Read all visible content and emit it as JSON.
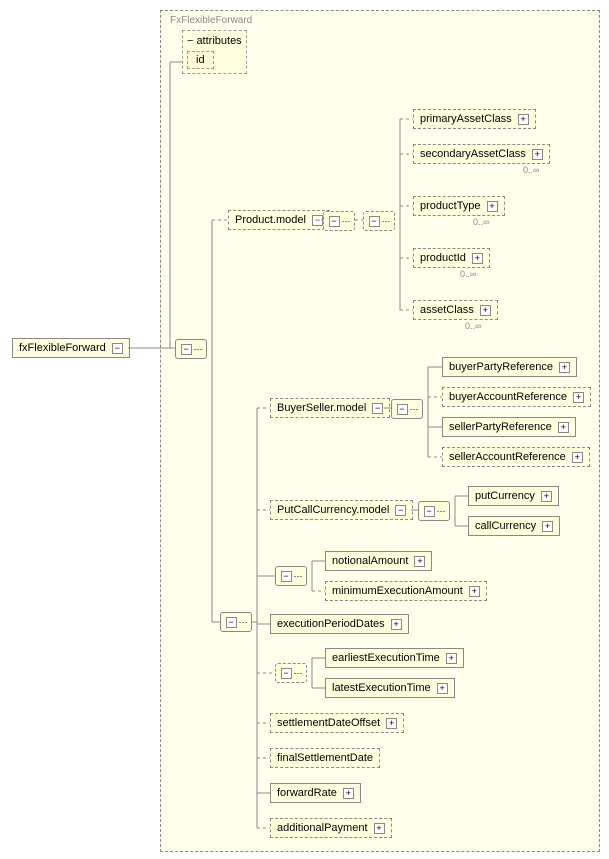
{
  "group": {
    "title": "FxFlexibleForward"
  },
  "root": {
    "label": "fxFlexibleForward"
  },
  "attributes": {
    "header": "attributes",
    "id": "id"
  },
  "productModel": {
    "label": "Product.model",
    "primaryAssetClass": "primaryAssetClass",
    "secondaryAssetClass": "secondaryAssetClass",
    "productType": "productType",
    "productId": "productId",
    "assetClass": "assetClass"
  },
  "buyerSeller": {
    "label": "BuyerSeller.model",
    "buyerPartyReference": "buyerPartyReference",
    "buyerAccountReference": "buyerAccountReference",
    "sellerPartyReference": "sellerPartyReference",
    "sellerAccountReference": "sellerAccountReference"
  },
  "putCall": {
    "label": "PutCallCurrency.model",
    "putCurrency": "putCurrency",
    "callCurrency": "callCurrency"
  },
  "amounts": {
    "notionalAmount": "notionalAmount",
    "minimumExecutionAmount": "minimumExecutionAmount"
  },
  "executionPeriodDates": "executionPeriodDates",
  "execTimes": {
    "earliestExecutionTime": "earliestExecutionTime",
    "latestExecutionTime": "latestExecutionTime"
  },
  "settlementDateOffset": "settlementDateOffset",
  "finalSettlementDate": "finalSettlementDate",
  "forwardRate": "forwardRate",
  "additionalPayment": "additionalPayment",
  "occur": {
    "zeroInf": "0..∞"
  },
  "glyph": {
    "minus": "−",
    "plus": "+",
    "seq": "⋯"
  }
}
